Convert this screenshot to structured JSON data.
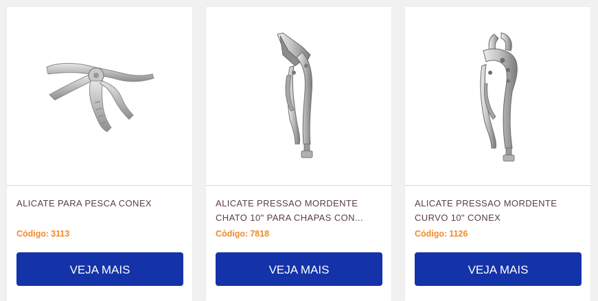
{
  "products": [
    {
      "title": "ALICATE PARA PESCA CONEX",
      "code_label": "Código:",
      "code": "3113",
      "button": "VEJA MAIS",
      "image": "fishing-pliers-icon"
    },
    {
      "title": "ALICATE PRESSAO MORDENTE\nCHATO 10\" PARA CHAPAS CON...",
      "code_label": "Código:",
      "code": "7818",
      "button": "VEJA MAIS",
      "image": "flat-locking-pliers-icon"
    },
    {
      "title": "ALICATE PRESSAO MORDENTE\nCURVO 10\" CONEX",
      "code_label": "Código:",
      "code": "1126",
      "button": "VEJA MAIS",
      "image": "curved-locking-pliers-icon"
    }
  ],
  "colors": {
    "background": "#f1f1f1",
    "card": "#ffffff",
    "title": "#5a3a4a",
    "code": "#ef8a2d",
    "button": "#1533a8",
    "button_text": "#ffffff"
  }
}
